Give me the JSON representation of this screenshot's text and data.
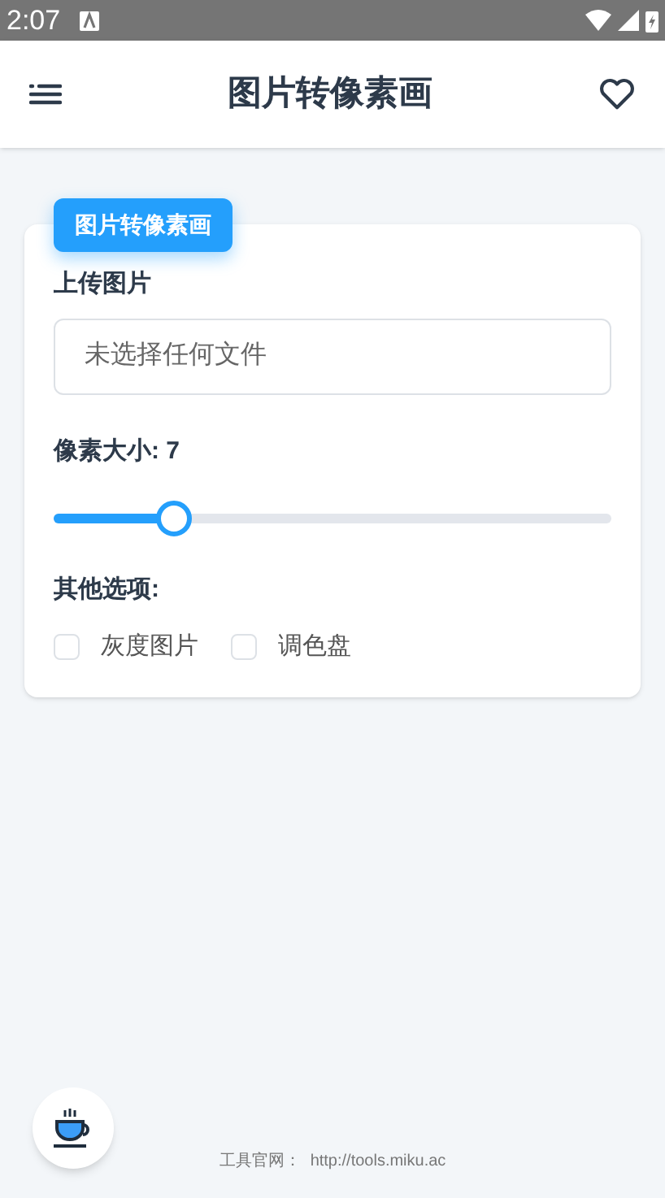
{
  "status_bar": {
    "time": "2:07"
  },
  "header": {
    "title": "图片转像素画"
  },
  "card": {
    "badge": "图片转像素画",
    "upload": {
      "label": "上传图片",
      "placeholder": "未选择任何文件"
    },
    "pixel_size": {
      "label": "像素大小: 7",
      "level": 0.217
    },
    "options": {
      "label": "其他选项:",
      "items": [
        {
          "label": "灰度图片",
          "checked": false
        },
        {
          "label": "调色盘",
          "checked": false
        }
      ]
    }
  },
  "footer": {
    "label": "工具官网：",
    "link": "http://tools.miku.ac"
  }
}
